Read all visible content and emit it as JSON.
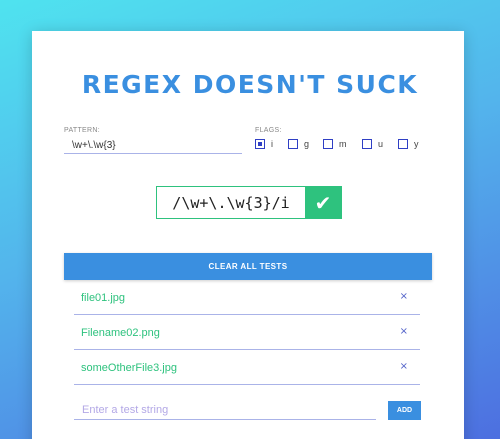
{
  "app": {
    "title": "REGEX DOESN'T SUCK"
  },
  "pattern": {
    "label": "PATTERN:",
    "value": "\\w+\\.\\w{3}"
  },
  "flags": {
    "label": "FLAGS:",
    "items": [
      {
        "name": "i",
        "checked": true
      },
      {
        "name": "g",
        "checked": false
      },
      {
        "name": "m",
        "checked": false
      },
      {
        "name": "u",
        "checked": false
      },
      {
        "name": "y",
        "checked": false
      }
    ]
  },
  "result": {
    "regex": "/\\w+\\.\\w{3}/i",
    "status_icon": "check-icon",
    "status_color": "#2ec27e"
  },
  "actions": {
    "clear_label": "CLEAR ALL TESTS",
    "add_label": "ADD"
  },
  "tests": [
    {
      "text": "file01.jpg",
      "remove_icon": "×"
    },
    {
      "text": "Filename02.png",
      "remove_icon": "×"
    },
    {
      "text": "someOtherFile3.jpg",
      "remove_icon": "×"
    }
  ],
  "new_test": {
    "placeholder": "Enter a test string",
    "value": ""
  },
  "colors": {
    "accent": "#3a8fe0",
    "match": "#2ec27e",
    "checkbox": "#2f3fc4"
  }
}
